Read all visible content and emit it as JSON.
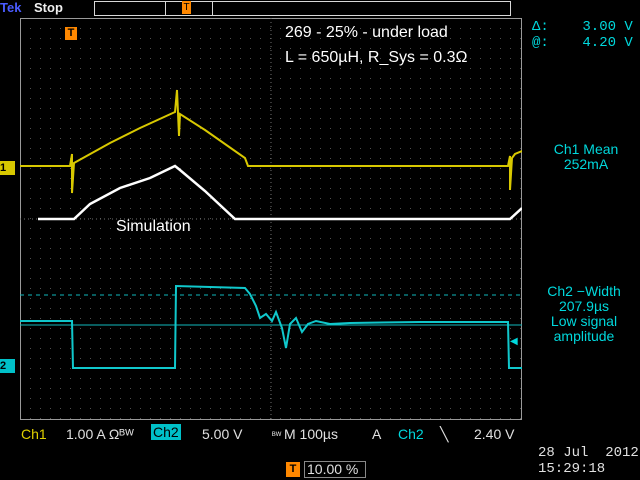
{
  "header": {
    "brand": "Tek",
    "run_status": "Stop"
  },
  "annotations": {
    "title": "269 - 25% - under load",
    "params": "L = 650µH, R_Sys = 0.3Ω",
    "simulation": "Simulation"
  },
  "cursors": {
    "delta": "Δ:    3.00 V",
    "at": "@:    4.20 V"
  },
  "measurements": {
    "ch1_mean_label": "Ch1 Mean",
    "ch1_mean_value": "252mA",
    "ch2_width_label": "Ch2 −Width",
    "ch2_width_value": "207.9µs",
    "ch2_note_1": "Low signal",
    "ch2_note_2": "amplitude"
  },
  "channel_markers": {
    "ch1": "1",
    "ch2": "2",
    "trigger": "T"
  },
  "status_bar": {
    "ch1_label": "Ch1",
    "ch1_scale": "1.00 A Ωᴮᵂ",
    "ch2_label": "Ch2",
    "ch2_scale": "5.00 V",
    "bw": "ᴮᵂ",
    "timebase": "M 100µs",
    "trigger_source": "A",
    "trigger_channel": "Ch2",
    "trigger_slope": "╲",
    "trigger_level": "2.40 V",
    "trigger_position": "10.00 %"
  },
  "datetime": {
    "date": "28 Jul  2012",
    "time": "15:29:18"
  },
  "colors": {
    "ch1": "#d8c800",
    "ch2": "#10c8cc",
    "simulation": "#ffffff",
    "trigger": "#ff8800",
    "brand": "#4a5cff"
  },
  "icons": {
    "trigger": "trigger-t-icon",
    "ref_arrow": "reference-arrow-icon"
  }
}
